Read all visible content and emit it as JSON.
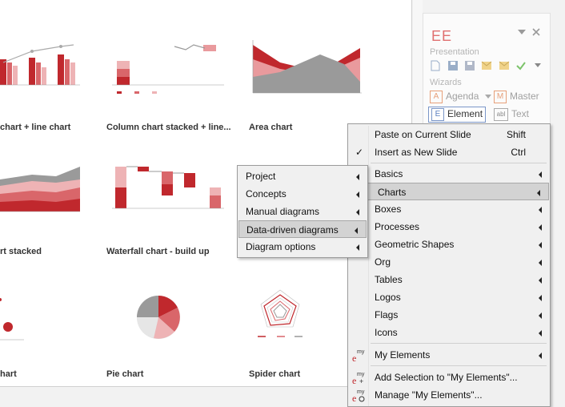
{
  "gallery": {
    "tiles": [
      {
        "label": "chart + line chart"
      },
      {
        "label": "Column chart stacked + line..."
      },
      {
        "label": "Area chart"
      },
      {
        "label": "rt stacked"
      },
      {
        "label": "Waterfall chart - build up"
      },
      {
        "label": ""
      },
      {
        "label": "hart"
      },
      {
        "label": "Pie chart"
      },
      {
        "label": "Spider chart"
      }
    ]
  },
  "panel": {
    "logo": "EE",
    "presentation_label": "Presentation",
    "wizards_label": "Wizards",
    "wizards": [
      {
        "label": "Agenda",
        "icon": "A"
      },
      {
        "label": "Master",
        "icon": "M"
      },
      {
        "label": "Element",
        "icon": "E"
      },
      {
        "label": "Text",
        "icon": "abl"
      }
    ]
  },
  "main_menu": {
    "items": [
      {
        "label": "Paste on Current Slide",
        "shortcut": "Shift"
      },
      {
        "label": "Insert as New Slide",
        "shortcut": "Ctrl"
      },
      {
        "label": "Basics"
      },
      {
        "label": "Charts"
      },
      {
        "label": "Boxes"
      },
      {
        "label": "Processes"
      },
      {
        "label": "Geometric Shapes"
      },
      {
        "label": "Org"
      },
      {
        "label": "Tables"
      },
      {
        "label": "Logos"
      },
      {
        "label": "Flags"
      },
      {
        "label": "Icons"
      },
      {
        "label": "My Elements"
      },
      {
        "label": "Add Selection to \"My Elements\"..."
      },
      {
        "label": "Manage \"My Elements\"..."
      }
    ]
  },
  "sub_menu": {
    "items": [
      {
        "label": "Project"
      },
      {
        "label": "Concepts"
      },
      {
        "label": "Manual diagrams"
      },
      {
        "label": "Data-driven diagrams"
      },
      {
        "label": "Diagram options"
      }
    ]
  },
  "colors": {
    "accent_red": "#c0282d",
    "mid_red": "#d9666a",
    "light_red": "#eeb3b5",
    "grey": "#9a9a9a",
    "menu_highlight": "#d3d3d3"
  }
}
